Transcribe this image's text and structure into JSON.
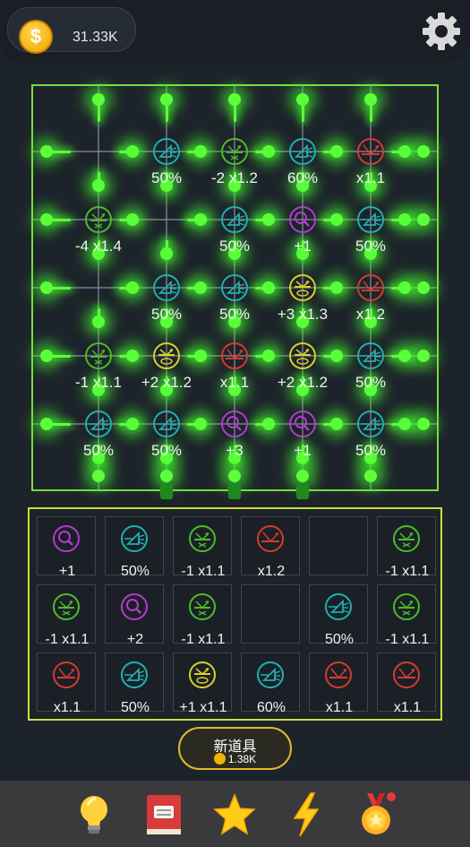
{
  "header": {
    "coins": "31.33K",
    "coin_symbol": "$"
  },
  "board": {
    "cells": [
      {
        "icon": "prism-icon",
        "color": "#1fb0b0",
        "label": "50%",
        "col": 1,
        "row": 0
      },
      {
        "icon": "mirror-splitter-icon",
        "color": "#4dbb2a",
        "label": "-2 x1.2",
        "col": 2,
        "row": 0
      },
      {
        "icon": "prism-icon",
        "color": "#1fb0b0",
        "label": "60%",
        "col": 3,
        "row": 0
      },
      {
        "icon": "reflector-icon",
        "color": "#d63a2e",
        "label": "x1.1",
        "col": 4,
        "row": 0
      },
      {
        "icon": "mirror-splitter-icon",
        "color": "#4dbb2a",
        "label": "-4 x1.4",
        "col": 0,
        "row": 1
      },
      {
        "icon": "prism-icon",
        "color": "#1fb0b0",
        "label": "50%",
        "col": 2,
        "row": 1
      },
      {
        "icon": "magnifier-icon",
        "color": "#b23ad0",
        "label": "+1",
        "col": 3,
        "row": 1
      },
      {
        "icon": "prism-icon",
        "color": "#1fb0b0",
        "label": "50%",
        "col": 4,
        "row": 1
      },
      {
        "icon": "prism-icon",
        "color": "#1fb0b0",
        "label": "50%",
        "col": 1,
        "row": 2
      },
      {
        "icon": "prism-icon",
        "color": "#1fb0b0",
        "label": "50%",
        "col": 2,
        "row": 2
      },
      {
        "icon": "lens-icon",
        "color": "#d8d02a",
        "label": "+3 x1.3",
        "col": 3,
        "row": 2
      },
      {
        "icon": "reflector-icon",
        "color": "#d63a2e",
        "label": "x1.2",
        "col": 4,
        "row": 2
      },
      {
        "icon": "mirror-splitter-icon",
        "color": "#4dbb2a",
        "label": "-1 x1.1",
        "col": 0,
        "row": 3
      },
      {
        "icon": "lens-icon",
        "color": "#d8d02a",
        "label": "+2 x1.2",
        "col": 1,
        "row": 3
      },
      {
        "icon": "reflector-icon",
        "color": "#d63a2e",
        "label": "x1.1",
        "col": 2,
        "row": 3
      },
      {
        "icon": "lens-icon",
        "color": "#d8d02a",
        "label": "+2 x1.2",
        "col": 3,
        "row": 3
      },
      {
        "icon": "prism-icon",
        "color": "#1fb0b0",
        "label": "50%",
        "col": 4,
        "row": 3
      },
      {
        "icon": "prism-icon",
        "color": "#1fb0b0",
        "label": "50%",
        "col": 0,
        "row": 4
      },
      {
        "icon": "prism-icon",
        "color": "#1fb0b0",
        "label": "50%",
        "col": 1,
        "row": 4
      },
      {
        "icon": "magnifier-icon",
        "color": "#b23ad0",
        "label": "+3",
        "col": 2,
        "row": 4
      },
      {
        "icon": "magnifier-icon",
        "color": "#b23ad0",
        "label": "+1",
        "col": 3,
        "row": 4
      },
      {
        "icon": "prism-icon",
        "color": "#1fb0b0",
        "label": "50%",
        "col": 4,
        "row": 4
      }
    ]
  },
  "inventory": {
    "slots": [
      {
        "icon": "magnifier-icon",
        "color": "#b23ad0",
        "label": "+1"
      },
      {
        "icon": "prism-icon",
        "color": "#1fb0b0",
        "label": "50%"
      },
      {
        "icon": "mirror-splitter-icon",
        "color": "#4dbb2a",
        "label": "-1 x1.1"
      },
      {
        "icon": "reflector-icon",
        "color": "#d63a2e",
        "label": "x1.2"
      },
      {
        "icon": null,
        "color": null,
        "label": ""
      },
      {
        "icon": "mirror-splitter-icon",
        "color": "#4dbb2a",
        "label": "-1 x1.1"
      },
      {
        "icon": "mirror-splitter-icon",
        "color": "#4dbb2a",
        "label": "-1 x1.1"
      },
      {
        "icon": "magnifier-icon",
        "color": "#b23ad0",
        "label": "+2"
      },
      {
        "icon": "mirror-splitter-icon",
        "color": "#4dbb2a",
        "label": "-1 x1.1"
      },
      {
        "icon": null,
        "color": null,
        "label": ""
      },
      {
        "icon": "prism-icon",
        "color": "#1fb0b0",
        "label": "50%"
      },
      {
        "icon": "mirror-splitter-icon",
        "color": "#4dbb2a",
        "label": "-1 x1.1"
      },
      {
        "icon": "reflector-icon",
        "color": "#d63a2e",
        "label": "x1.1"
      },
      {
        "icon": "prism-icon",
        "color": "#1fb0b0",
        "label": "50%"
      },
      {
        "icon": "lens-icon",
        "color": "#d8d02a",
        "label": "+1 x1.1"
      },
      {
        "icon": "prism-icon",
        "color": "#1fb0b0",
        "label": "60%"
      },
      {
        "icon": "reflector-icon",
        "color": "#d63a2e",
        "label": "x1.1"
      },
      {
        "icon": "reflector-icon",
        "color": "#d63a2e",
        "label": "x1.1"
      }
    ]
  },
  "new_item_button": {
    "label": "新道具",
    "cost": "1.38K"
  },
  "nav": [
    {
      "name": "nav-lightbulb",
      "icon": "lightbulb-icon"
    },
    {
      "name": "nav-book",
      "icon": "book-icon"
    },
    {
      "name": "nav-star",
      "icon": "star-icon"
    },
    {
      "name": "nav-lightning",
      "icon": "lightning-icon"
    },
    {
      "name": "nav-medal",
      "icon": "medal-icon"
    }
  ],
  "colors": {
    "board_border": "#7bdc3a",
    "inventory_border": "#c9de3c",
    "laser": "#5eff3a",
    "button_border": "#e2b925"
  }
}
